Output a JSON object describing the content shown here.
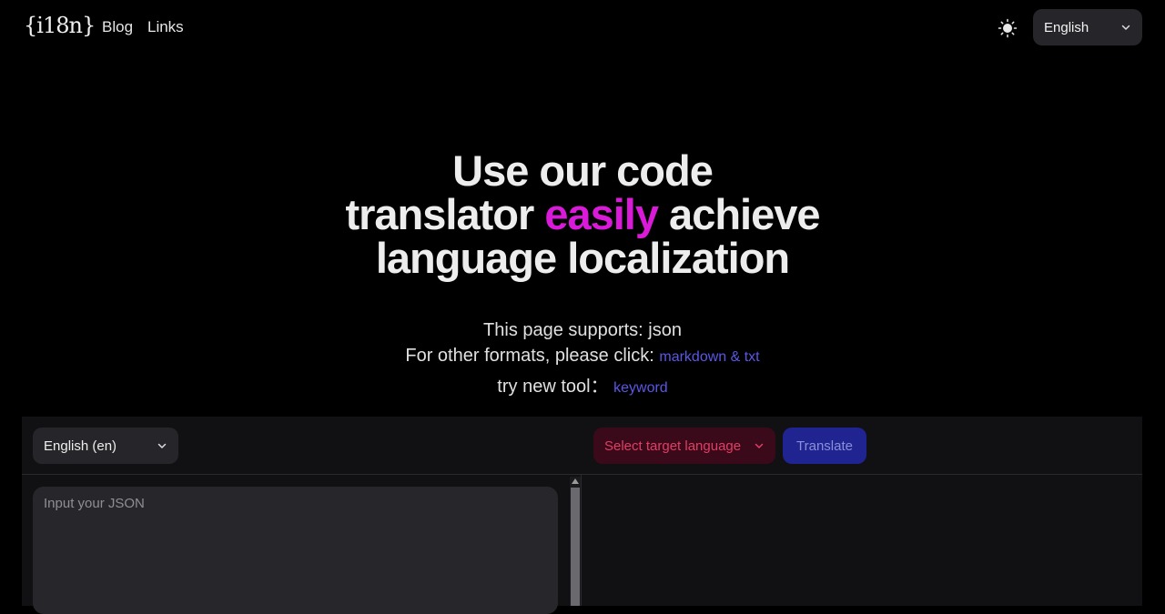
{
  "nav": {
    "logo": "{i18n}",
    "links": [
      "Blog",
      "Links"
    ],
    "theme_icon": "sun-icon",
    "language": "English"
  },
  "hero": {
    "line1": "Use our code",
    "line2_a": "translator ",
    "line2_accent": "easily",
    "line2_b": " achieve",
    "line3": "language localization"
  },
  "info": {
    "supports_label": "This page supports:  json",
    "other_label": "For other formats, please click: ",
    "other_link": "markdown & txt",
    "try_label": "try new tool： ",
    "try_link": "keyword"
  },
  "translator": {
    "source_language": "English (en)",
    "target_placeholder": "Select target language",
    "translate_label": "Translate",
    "input_placeholder": "Input your JSON"
  },
  "colors": {
    "accent": "#d91ad9",
    "link": "#5b57e6",
    "target_select_text": "#e23d65",
    "translate_button": "#1f2490"
  }
}
